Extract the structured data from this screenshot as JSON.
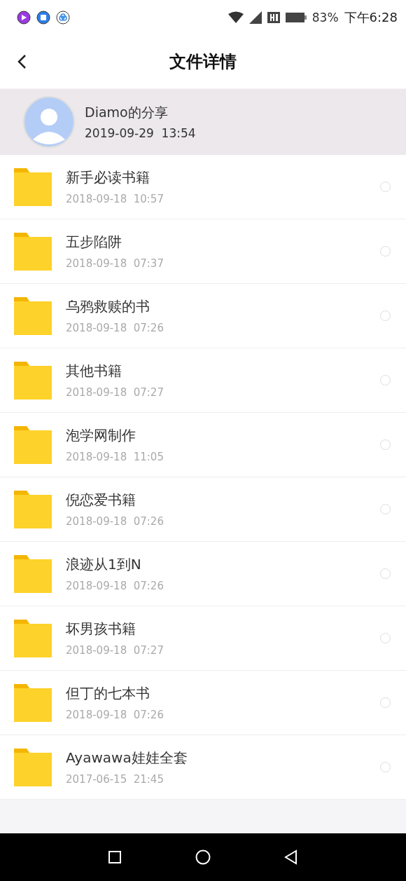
{
  "status_bar": {
    "battery": "83%",
    "time": "下午6:28"
  },
  "header": {
    "title": "文件详情"
  },
  "share": {
    "name": "Diamo的分享",
    "time": "2019-09-29  13:54"
  },
  "files": [
    {
      "name": "新手必读书籍",
      "time": "2018-09-18  10:57",
      "selected": false
    },
    {
      "name": "五步陷阱",
      "time": "2018-09-18  07:37",
      "selected": false
    },
    {
      "name": "乌鸦救赎的书",
      "time": "2018-09-18  07:26",
      "selected": false
    },
    {
      "name": "其他书籍",
      "time": "2018-09-18  07:27",
      "selected": false
    },
    {
      "name": "泡学网制作",
      "time": "2018-09-18  11:05",
      "selected": false
    },
    {
      "name": "倪恋爱书籍",
      "time": "2018-09-18  07:26",
      "selected": false
    },
    {
      "name": "浪迹从1到N",
      "time": "2018-09-18  07:26",
      "selected": false
    },
    {
      "name": "坏男孩书籍",
      "time": "2018-09-18  07:27",
      "selected": false
    },
    {
      "name": "但丁的七本书",
      "time": "2018-09-18  07:26",
      "selected": false
    },
    {
      "name": "Ayawawa娃娃全套",
      "time": "2017-06-15  21:45",
      "selected": false
    }
  ]
}
